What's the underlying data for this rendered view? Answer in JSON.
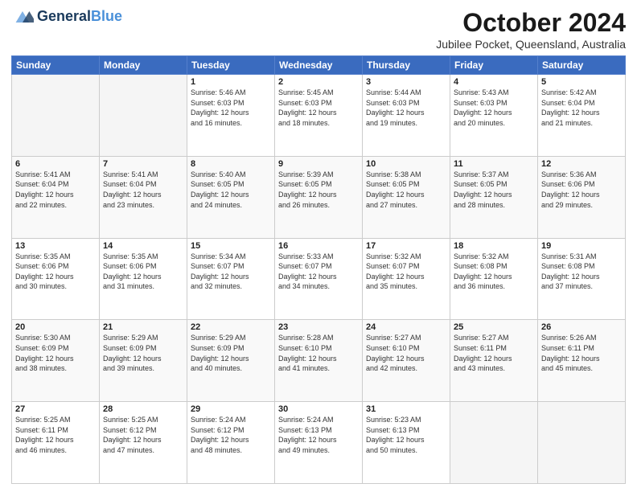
{
  "header": {
    "logo_general": "General",
    "logo_blue": "Blue",
    "month_title": "October 2024",
    "location": "Jubilee Pocket, Queensland, Australia"
  },
  "days_of_week": [
    "Sunday",
    "Monday",
    "Tuesday",
    "Wednesday",
    "Thursday",
    "Friday",
    "Saturday"
  ],
  "weeks": [
    [
      {
        "day": "",
        "info": ""
      },
      {
        "day": "",
        "info": ""
      },
      {
        "day": "1",
        "info": "Sunrise: 5:46 AM\nSunset: 6:03 PM\nDaylight: 12 hours\nand 16 minutes."
      },
      {
        "day": "2",
        "info": "Sunrise: 5:45 AM\nSunset: 6:03 PM\nDaylight: 12 hours\nand 18 minutes."
      },
      {
        "day": "3",
        "info": "Sunrise: 5:44 AM\nSunset: 6:03 PM\nDaylight: 12 hours\nand 19 minutes."
      },
      {
        "day": "4",
        "info": "Sunrise: 5:43 AM\nSunset: 6:03 PM\nDaylight: 12 hours\nand 20 minutes."
      },
      {
        "day": "5",
        "info": "Sunrise: 5:42 AM\nSunset: 6:04 PM\nDaylight: 12 hours\nand 21 minutes."
      }
    ],
    [
      {
        "day": "6",
        "info": "Sunrise: 5:41 AM\nSunset: 6:04 PM\nDaylight: 12 hours\nand 22 minutes."
      },
      {
        "day": "7",
        "info": "Sunrise: 5:41 AM\nSunset: 6:04 PM\nDaylight: 12 hours\nand 23 minutes."
      },
      {
        "day": "8",
        "info": "Sunrise: 5:40 AM\nSunset: 6:05 PM\nDaylight: 12 hours\nand 24 minutes."
      },
      {
        "day": "9",
        "info": "Sunrise: 5:39 AM\nSunset: 6:05 PM\nDaylight: 12 hours\nand 26 minutes."
      },
      {
        "day": "10",
        "info": "Sunrise: 5:38 AM\nSunset: 6:05 PM\nDaylight: 12 hours\nand 27 minutes."
      },
      {
        "day": "11",
        "info": "Sunrise: 5:37 AM\nSunset: 6:05 PM\nDaylight: 12 hours\nand 28 minutes."
      },
      {
        "day": "12",
        "info": "Sunrise: 5:36 AM\nSunset: 6:06 PM\nDaylight: 12 hours\nand 29 minutes."
      }
    ],
    [
      {
        "day": "13",
        "info": "Sunrise: 5:35 AM\nSunset: 6:06 PM\nDaylight: 12 hours\nand 30 minutes."
      },
      {
        "day": "14",
        "info": "Sunrise: 5:35 AM\nSunset: 6:06 PM\nDaylight: 12 hours\nand 31 minutes."
      },
      {
        "day": "15",
        "info": "Sunrise: 5:34 AM\nSunset: 6:07 PM\nDaylight: 12 hours\nand 32 minutes."
      },
      {
        "day": "16",
        "info": "Sunrise: 5:33 AM\nSunset: 6:07 PM\nDaylight: 12 hours\nand 34 minutes."
      },
      {
        "day": "17",
        "info": "Sunrise: 5:32 AM\nSunset: 6:07 PM\nDaylight: 12 hours\nand 35 minutes."
      },
      {
        "day": "18",
        "info": "Sunrise: 5:32 AM\nSunset: 6:08 PM\nDaylight: 12 hours\nand 36 minutes."
      },
      {
        "day": "19",
        "info": "Sunrise: 5:31 AM\nSunset: 6:08 PM\nDaylight: 12 hours\nand 37 minutes."
      }
    ],
    [
      {
        "day": "20",
        "info": "Sunrise: 5:30 AM\nSunset: 6:09 PM\nDaylight: 12 hours\nand 38 minutes."
      },
      {
        "day": "21",
        "info": "Sunrise: 5:29 AM\nSunset: 6:09 PM\nDaylight: 12 hours\nand 39 minutes."
      },
      {
        "day": "22",
        "info": "Sunrise: 5:29 AM\nSunset: 6:09 PM\nDaylight: 12 hours\nand 40 minutes."
      },
      {
        "day": "23",
        "info": "Sunrise: 5:28 AM\nSunset: 6:10 PM\nDaylight: 12 hours\nand 41 minutes."
      },
      {
        "day": "24",
        "info": "Sunrise: 5:27 AM\nSunset: 6:10 PM\nDaylight: 12 hours\nand 42 minutes."
      },
      {
        "day": "25",
        "info": "Sunrise: 5:27 AM\nSunset: 6:11 PM\nDaylight: 12 hours\nand 43 minutes."
      },
      {
        "day": "26",
        "info": "Sunrise: 5:26 AM\nSunset: 6:11 PM\nDaylight: 12 hours\nand 45 minutes."
      }
    ],
    [
      {
        "day": "27",
        "info": "Sunrise: 5:25 AM\nSunset: 6:11 PM\nDaylight: 12 hours\nand 46 minutes."
      },
      {
        "day": "28",
        "info": "Sunrise: 5:25 AM\nSunset: 6:12 PM\nDaylight: 12 hours\nand 47 minutes."
      },
      {
        "day": "29",
        "info": "Sunrise: 5:24 AM\nSunset: 6:12 PM\nDaylight: 12 hours\nand 48 minutes."
      },
      {
        "day": "30",
        "info": "Sunrise: 5:24 AM\nSunset: 6:13 PM\nDaylight: 12 hours\nand 49 minutes."
      },
      {
        "day": "31",
        "info": "Sunrise: 5:23 AM\nSunset: 6:13 PM\nDaylight: 12 hours\nand 50 minutes."
      },
      {
        "day": "",
        "info": ""
      },
      {
        "day": "",
        "info": ""
      }
    ]
  ]
}
